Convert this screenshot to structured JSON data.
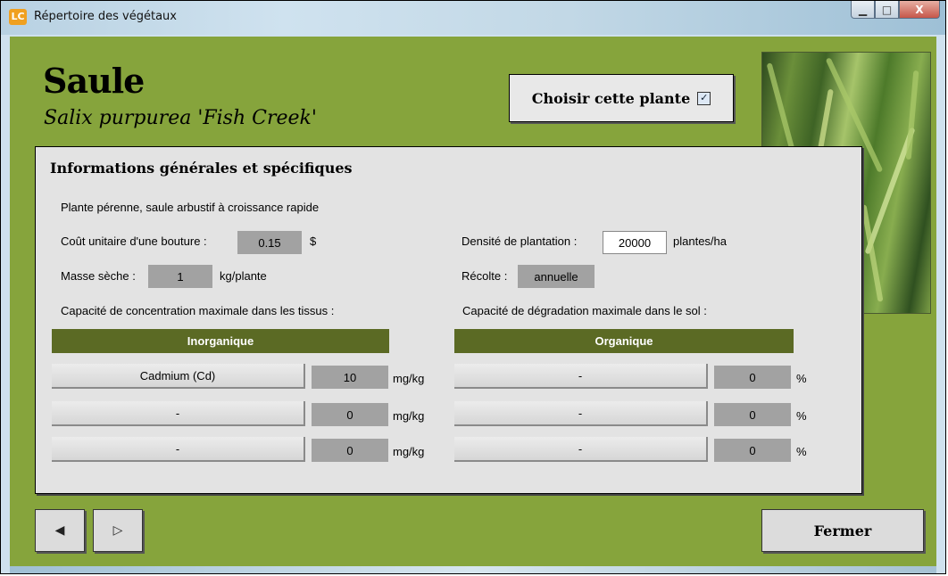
{
  "window": {
    "title": "Répertoire des végétaux",
    "app_icon_text": "LC",
    "minimize_glyph": "▁",
    "maximize_glyph": "□",
    "close_glyph": "X"
  },
  "plant": {
    "name": "Saule",
    "latin_name": "Salix purpurea 'Fish Creek'",
    "choose_label": "Choisir cette plante",
    "chosen": "✓"
  },
  "info": {
    "section_title": "Informations générales et spécifiques",
    "description": "Plante pérenne, saule arbustif à croissance rapide",
    "cost_label": "Coût unitaire d'une bouture :",
    "cost_value": "0.15",
    "cost_unit": "$",
    "mass_label": "Masse sèche :",
    "mass_value": "1",
    "mass_unit": "kg/plante",
    "density_label": "Densité de plantation :",
    "density_value": "20000",
    "density_unit": "plantes/ha",
    "harvest_label": "Récolte :",
    "harvest_value": "annuelle",
    "concentration_label": "Capacité de concentration maximale dans les tissus :",
    "degradation_label": "Capacité de dégradation maximale dans le sol :"
  },
  "inorganic": {
    "header": "Inorganique",
    "rows": [
      {
        "name": "Cadmium (Cd)",
        "value": "10",
        "unit": "mg/kg"
      },
      {
        "name": "-",
        "value": "0",
        "unit": "mg/kg"
      },
      {
        "name": "-",
        "value": "0",
        "unit": "mg/kg"
      }
    ]
  },
  "organic": {
    "header": "Organique",
    "rows": [
      {
        "name": "-",
        "value": "0",
        "unit": "%"
      },
      {
        "name": "-",
        "value": "0",
        "unit": "%"
      },
      {
        "name": "-",
        "value": "0",
        "unit": "%"
      }
    ]
  },
  "footer": {
    "prev_glyph": "◀",
    "next_glyph": "▷",
    "close_label": "Fermer"
  },
  "colors": {
    "client_bg": "#86a43c",
    "table_header": "#5b6a24",
    "value_box": "#a2a2a2"
  },
  "icons": {
    "app": "app-logo-icon",
    "photo": "willow-photo"
  }
}
